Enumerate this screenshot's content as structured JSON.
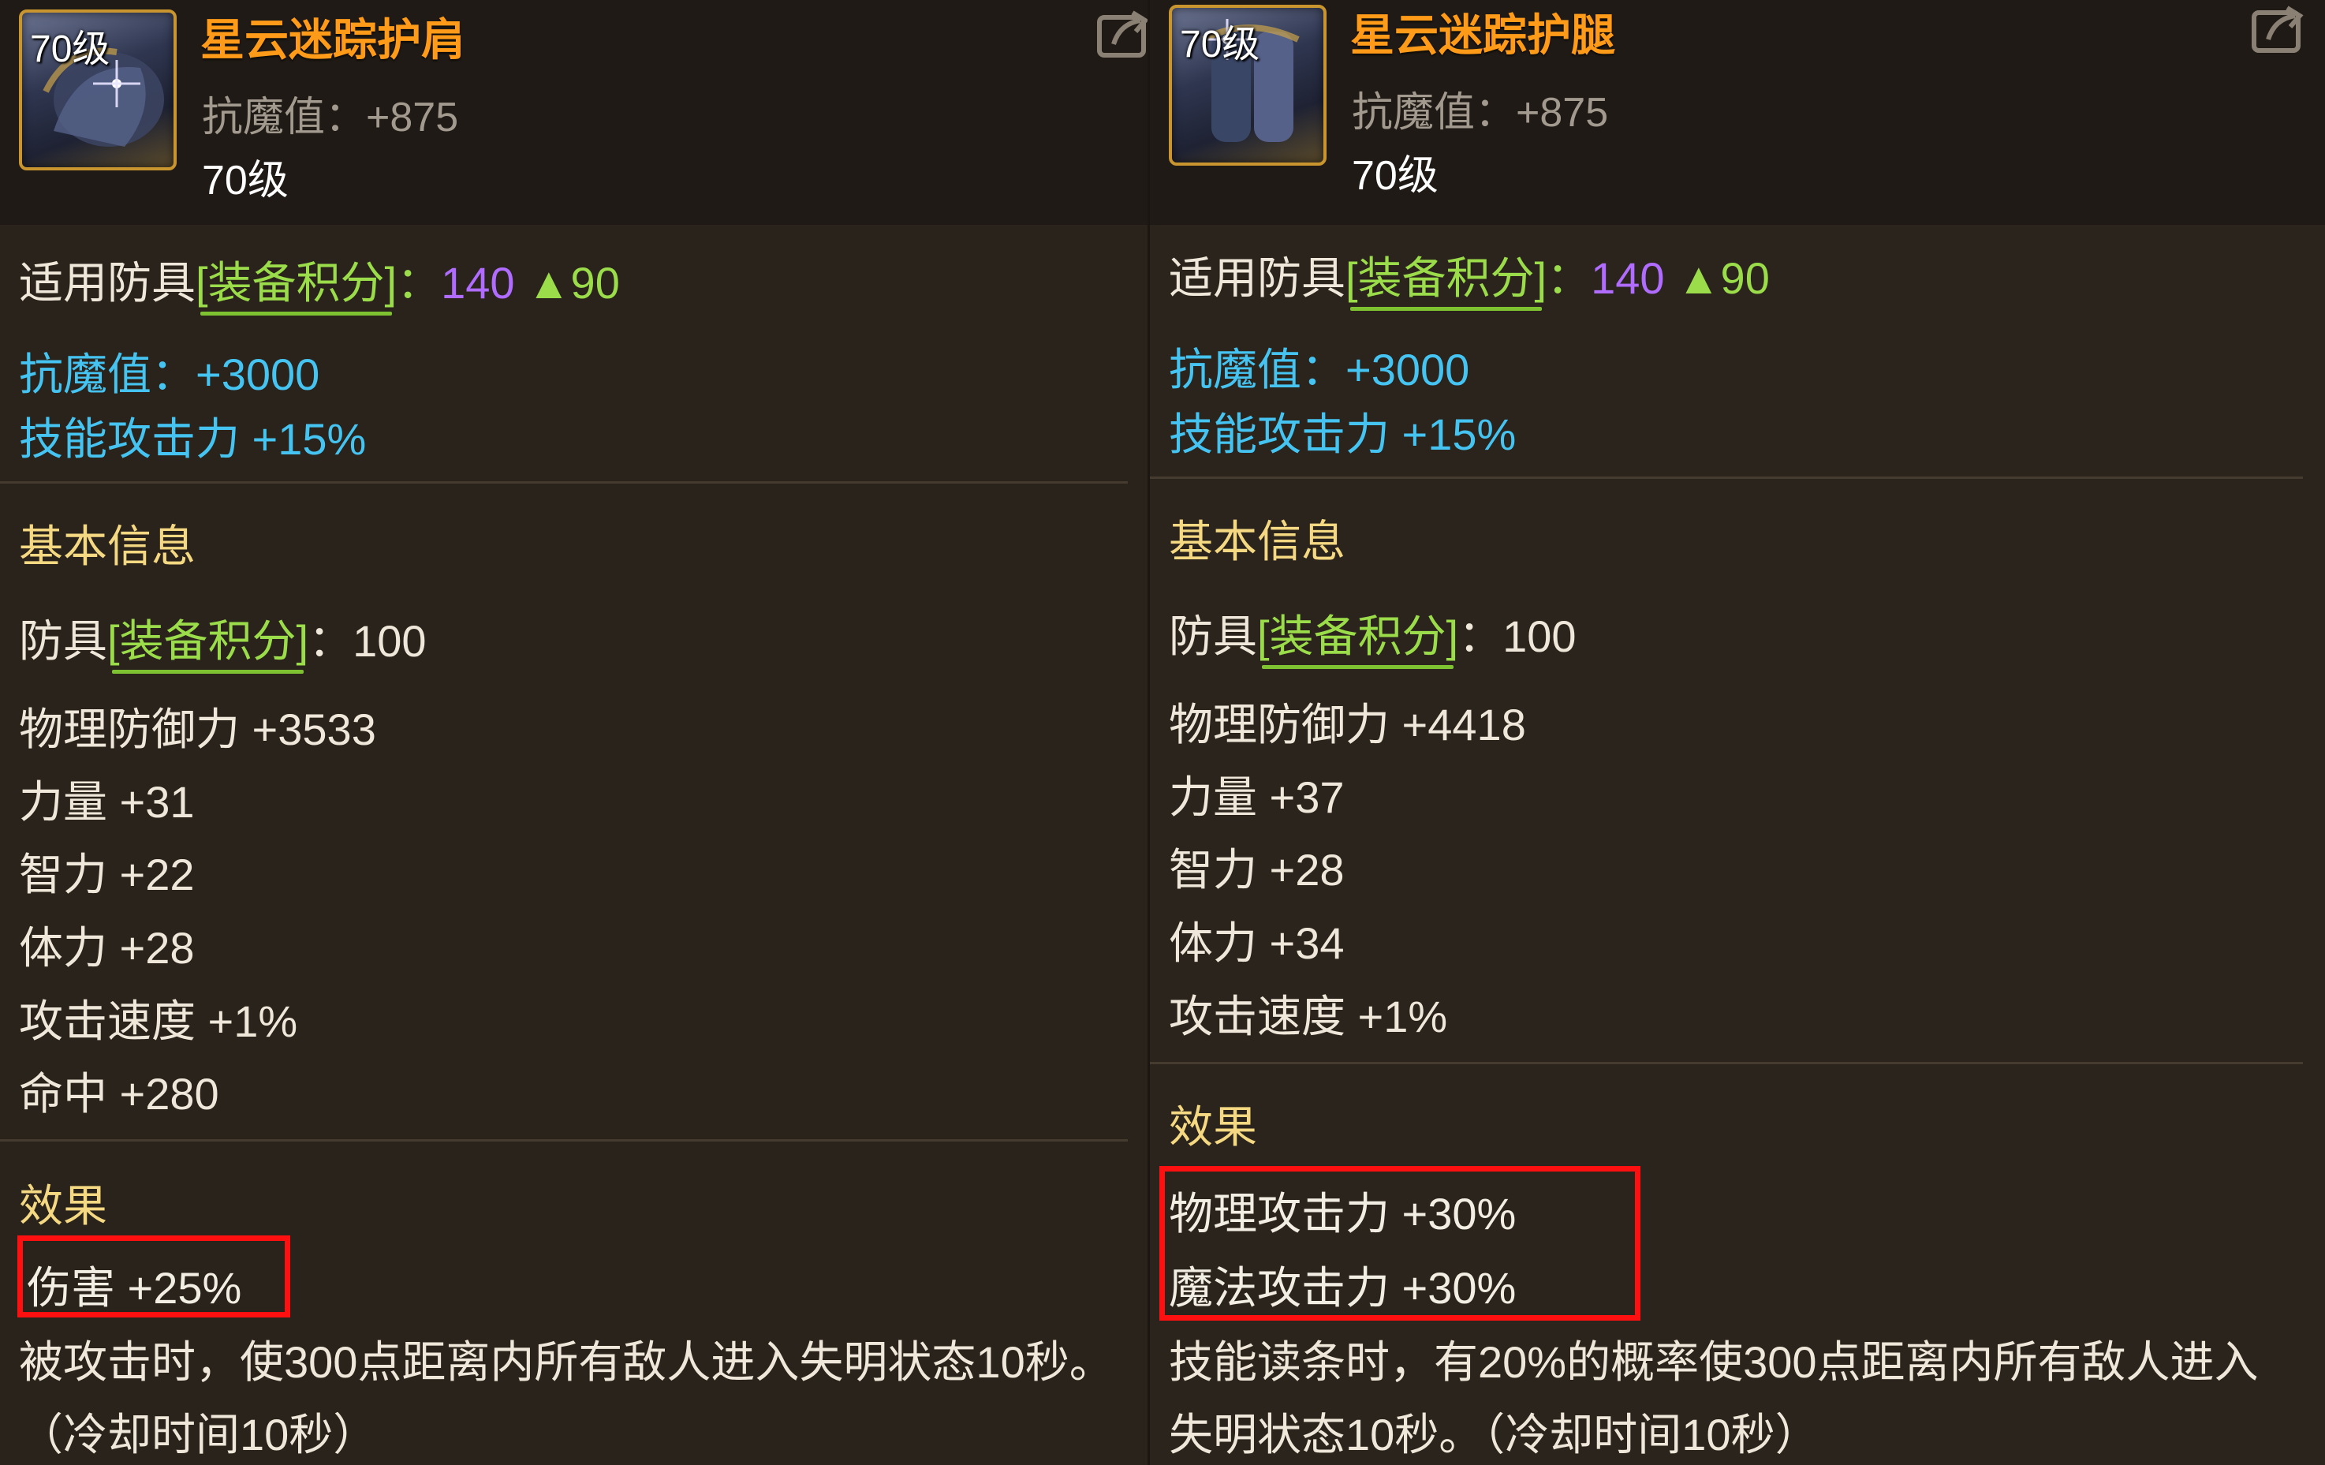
{
  "colors": {
    "item_name": "#ff9b19",
    "bracket_green": "#9bdc4a",
    "score_purple": "#b06cff",
    "cyan_stat": "#45c4f2",
    "section_gold": "#f5d882",
    "highlight_red": "#ff1010",
    "background": "#2a231b"
  },
  "left": {
    "icon": {
      "level": "70级",
      "name": "shoulder-armor-icon"
    },
    "header": {
      "name": "星云迷踪护肩",
      "resist": "抗魔值：+875",
      "level": "70级"
    },
    "score": {
      "prefix": "适用防具",
      "label": "[装备积分]",
      "colon": "：",
      "value": "140",
      "up": "▲90"
    },
    "bonus": [
      "抗魔值：+3000",
      "技能攻击力 +15%"
    ],
    "basic_title": "基本信息",
    "armor_score": {
      "prefix": "防具",
      "label": "[装备积分]",
      "rest": "：100"
    },
    "stats": [
      "物理防御力 +3533",
      "力量 +31",
      "智力 +22",
      "体力 +28",
      "攻击速度 +1%",
      "命中 +280"
    ],
    "effect_title": "效果",
    "effects": [
      "伤害 +25%"
    ],
    "desc": [
      "被攻击时，使300点距离内所有敌人进入失明状态10秒。",
      "（冷却时间10秒）"
    ]
  },
  "right": {
    "icon": {
      "level": "70级",
      "name": "leg-armor-icon"
    },
    "header": {
      "name": "星云迷踪护腿",
      "resist": "抗魔值：+875",
      "level": "70级"
    },
    "score": {
      "prefix": "适用防具",
      "label": "[装备积分]",
      "colon": "：",
      "value": "140",
      "up": "▲90"
    },
    "bonus": [
      "抗魔值：+3000",
      "技能攻击力 +15%"
    ],
    "basic_title": "基本信息",
    "armor_score": {
      "prefix": "防具",
      "label": "[装备积分]",
      "rest": "：100"
    },
    "stats": [
      "物理防御力 +4418",
      "力量 +37",
      "智力 +28",
      "体力 +34",
      "攻击速度 +1%"
    ],
    "effect_title": "效果",
    "effects": [
      "物理攻击力 +30%",
      "魔法攻击力 +30%"
    ],
    "desc": [
      "技能读条时，有20%的概率使300点距离内所有敌人进入",
      "失明状态10秒。（冷却时间10秒）"
    ]
  }
}
